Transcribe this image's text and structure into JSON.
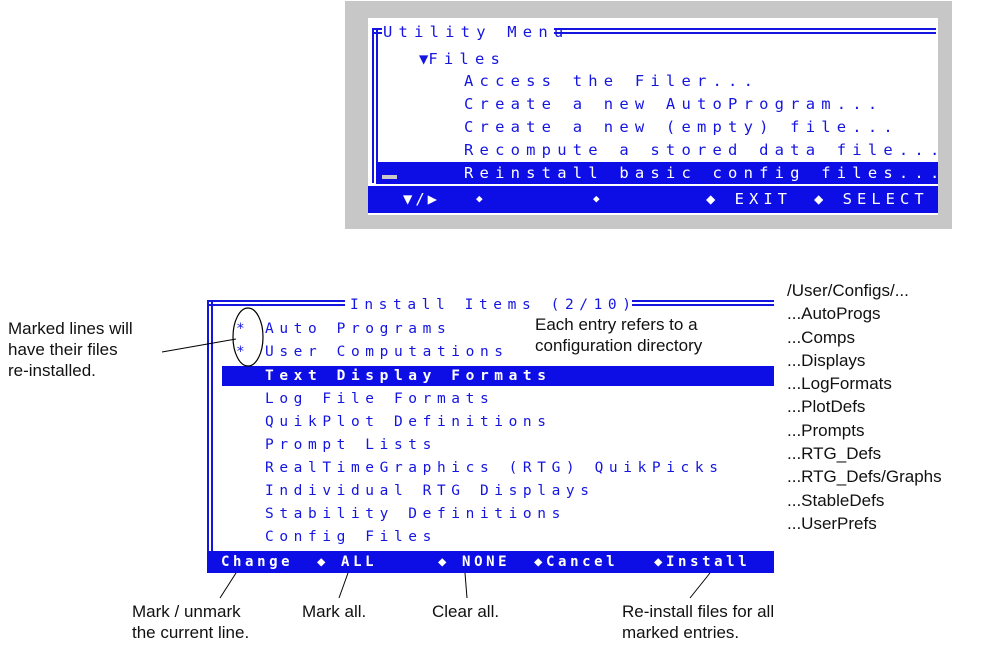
{
  "utility_menu": {
    "title": "Utility Menu",
    "section": "Files",
    "section_marker": "▼",
    "items": [
      "Access the Filer...",
      "Create a new AutoProgram...",
      "Create a new (empty) file...",
      "Recompute a stored data file...",
      "Reinstall basic config files..."
    ],
    "selected_index": 4,
    "footer": {
      "nav": "▼/▶",
      "diamond": "◆",
      "exit": "◆ EXIT",
      "select": "◆ SELECT"
    }
  },
  "install_items": {
    "title": "Install Items (2/10)",
    "items": [
      {
        "label": "Auto Programs",
        "marked": true
      },
      {
        "label": "User Computations",
        "marked": true
      },
      {
        "label": "Text Display Formats",
        "marked": false
      },
      {
        "label": "Log File Formats",
        "marked": false
      },
      {
        "label": "QuikPlot Definitions",
        "marked": false
      },
      {
        "label": "Prompt Lists",
        "marked": false
      },
      {
        "label": "RealTimeGraphics (RTG) QuikPicks",
        "marked": false
      },
      {
        "label": "Individual RTG Displays",
        "marked": false
      },
      {
        "label": "Stability Definitions",
        "marked": false
      },
      {
        "label": "Config Files",
        "marked": false
      }
    ],
    "mark_symbol": "*",
    "selected_index": 2,
    "footer": {
      "change": "Change",
      "all": "◆ ALL",
      "none": "◆ NONE",
      "cancel": "◆Cancel",
      "install": "◆Install"
    }
  },
  "annotations": {
    "marked_lines": [
      "Marked lines will",
      "have their files",
      "re-installed."
    ],
    "entry_refers": [
      "Each entry refers to a",
      "configuration directory"
    ],
    "change_note": [
      "Mark / unmark",
      "the current line."
    ],
    "all_note": [
      "Mark all."
    ],
    "none_note": [
      "Clear all."
    ],
    "install_note": [
      "Re-install files for all",
      "marked entries."
    ]
  },
  "directories": {
    "root": "/User/Configs/...",
    "entries": [
      "...AutoProgs",
      "...Comps",
      "...Displays",
      "...LogFormats",
      "...PlotDefs",
      "...Prompts",
      "...RTG_Defs",
      "...RTG_Defs/Graphs",
      "...StableDefs",
      "...UserPrefs"
    ]
  },
  "colors": {
    "screen_blue": "#1515e0",
    "highlight_bar": "#0d0de6",
    "panel_gray": "#c7c7c7"
  }
}
